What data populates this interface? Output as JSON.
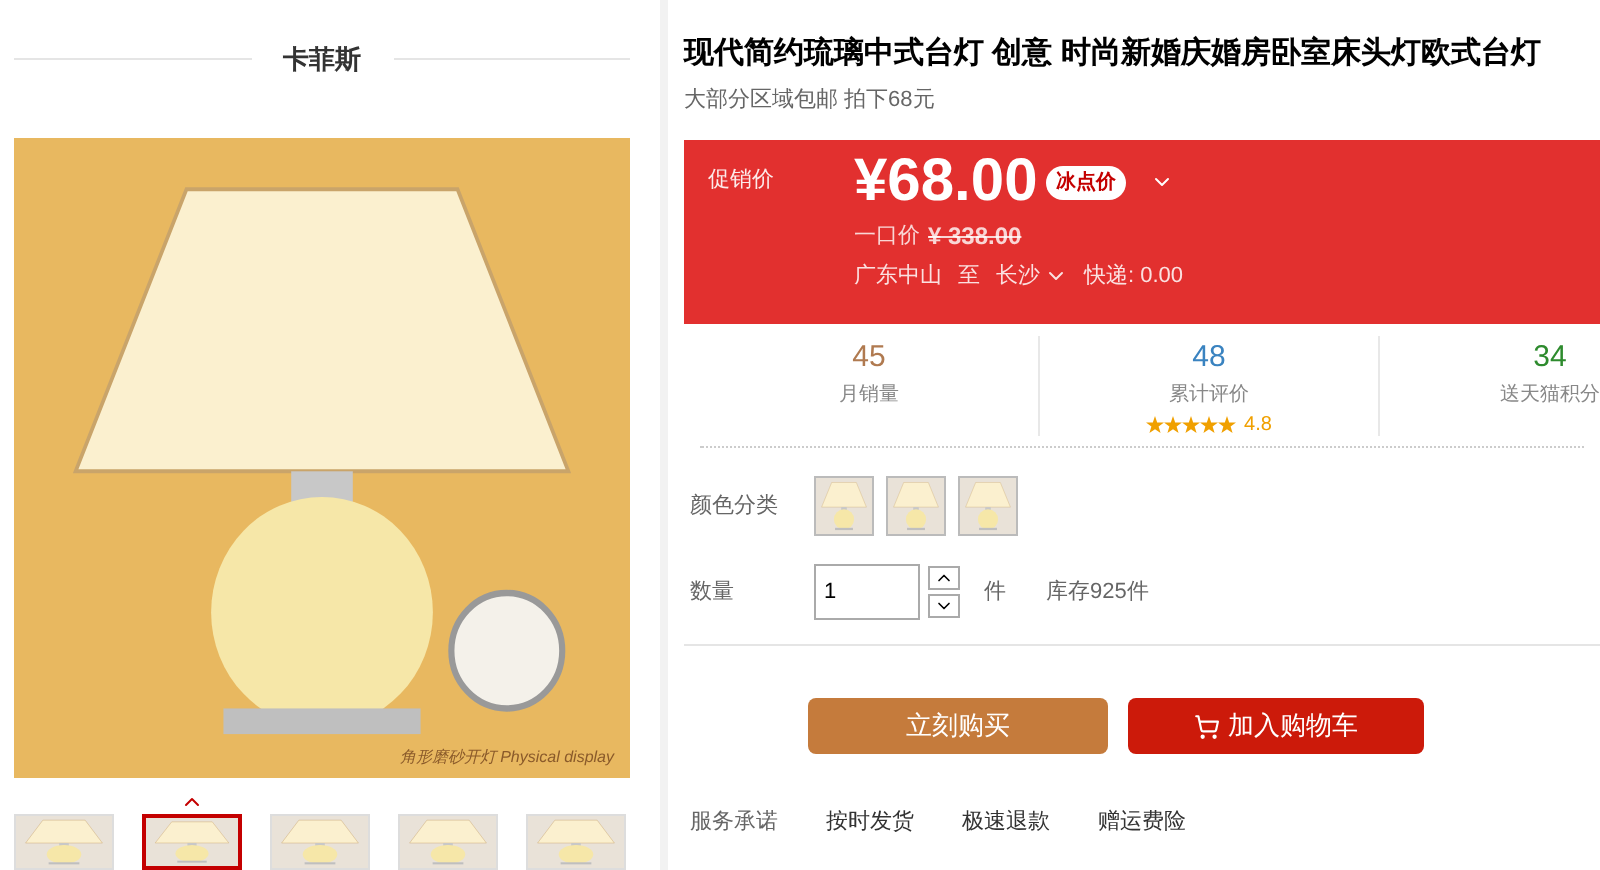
{
  "shop": {
    "name": "卡菲斯"
  },
  "gallery": {
    "watermark_caption": "角形磨砂开灯 Physical display",
    "thumbnails": [
      {
        "selected": false
      },
      {
        "selected": true
      },
      {
        "selected": false
      },
      {
        "selected": false
      },
      {
        "selected": false
      }
    ]
  },
  "product": {
    "title": "现代简约琉璃中式台灯 创意 时尚新婚庆婚房卧室床头灯欧式台灯",
    "subtitle": "大部分区域包邮 拍下68元"
  },
  "price_panel": {
    "label": "促销价",
    "price": "¥68.00",
    "badge": "冰点价",
    "original_label": "一口价",
    "original_price": "¥ 338.00",
    "origin": "广东中山",
    "to": "至",
    "destination": "长沙",
    "shipping": "快递: 0.00"
  },
  "stats": [
    {
      "value": "45",
      "label": "月销量",
      "color": "#b07a50"
    },
    {
      "value": "48",
      "label": "累计评价",
      "color": "#3a83c0",
      "stars": 5,
      "rating": "4.8"
    },
    {
      "value": "34",
      "label": "送天猫积分",
      "color": "#2e8b2e"
    }
  ],
  "options": {
    "color_label": "颜色分类",
    "swatches": [
      {
        "selected": false
      },
      {
        "selected": false
      },
      {
        "selected": false
      }
    ],
    "quantity_label": "数量",
    "quantity": "1",
    "unit": "件",
    "stock": "库存925件"
  },
  "buttons": [
    {
      "kind": "buy",
      "label": "立刻购买"
    },
    {
      "kind": "cart",
      "label": "加入购物车"
    }
  ],
  "services": {
    "label": "服务承诺",
    "items": [
      "按时发货",
      "极速退款",
      "赠运费险"
    ]
  }
}
